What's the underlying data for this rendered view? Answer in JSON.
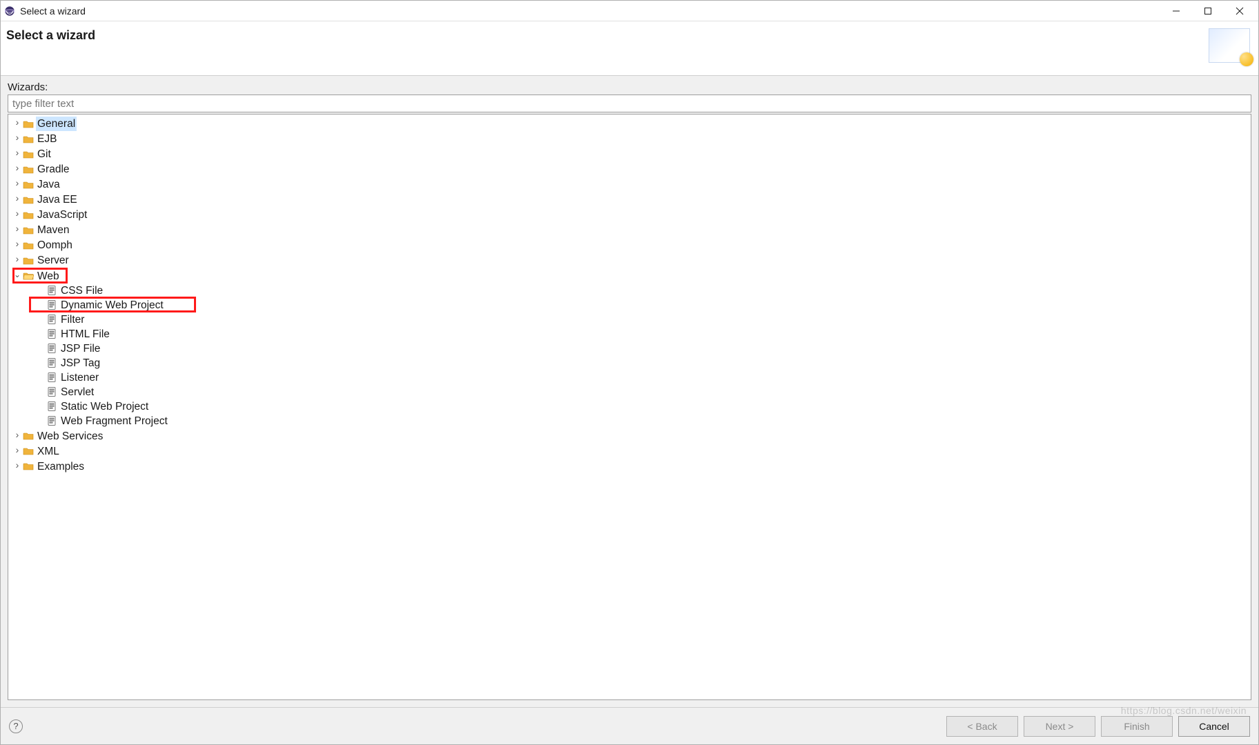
{
  "window": {
    "title": "Select a wizard"
  },
  "header": {
    "heading": "Select a wizard"
  },
  "wizards": {
    "label": "Wizards:",
    "filter_placeholder": "type filter text"
  },
  "tree": {
    "folders": [
      {
        "id": "general",
        "label": "General",
        "expanded": false,
        "selected": true
      },
      {
        "id": "ejb",
        "label": "EJB",
        "expanded": false
      },
      {
        "id": "git",
        "label": "Git",
        "expanded": false
      },
      {
        "id": "gradle",
        "label": "Gradle",
        "expanded": false
      },
      {
        "id": "java",
        "label": "Java",
        "expanded": false
      },
      {
        "id": "javaee",
        "label": "Java EE",
        "expanded": false
      },
      {
        "id": "javascript",
        "label": "JavaScript",
        "expanded": false
      },
      {
        "id": "maven",
        "label": "Maven",
        "expanded": false
      },
      {
        "id": "oomph",
        "label": "Oomph",
        "expanded": false
      },
      {
        "id": "server",
        "label": "Server",
        "expanded": false
      },
      {
        "id": "web",
        "label": "Web",
        "expanded": true,
        "highlighted": true,
        "children": [
          {
            "id": "css-file",
            "label": "CSS File"
          },
          {
            "id": "dynamic-web-project",
            "label": "Dynamic Web Project",
            "highlighted": true
          },
          {
            "id": "filter",
            "label": "Filter"
          },
          {
            "id": "html-file",
            "label": "HTML File"
          },
          {
            "id": "jsp-file",
            "label": "JSP File"
          },
          {
            "id": "jsp-tag",
            "label": "JSP Tag"
          },
          {
            "id": "listener",
            "label": "Listener"
          },
          {
            "id": "servlet",
            "label": "Servlet"
          },
          {
            "id": "static-web-project",
            "label": "Static Web Project"
          },
          {
            "id": "web-fragment-project",
            "label": "Web Fragment Project"
          }
        ]
      },
      {
        "id": "web-services",
        "label": "Web Services",
        "expanded": false
      },
      {
        "id": "xml",
        "label": "XML",
        "expanded": false
      },
      {
        "id": "examples",
        "label": "Examples",
        "expanded": false
      }
    ]
  },
  "footer": {
    "back": "< Back",
    "next": "Next >",
    "finish": "Finish",
    "cancel": "Cancel"
  },
  "watermark": "https://blog.csdn.net/weixin"
}
